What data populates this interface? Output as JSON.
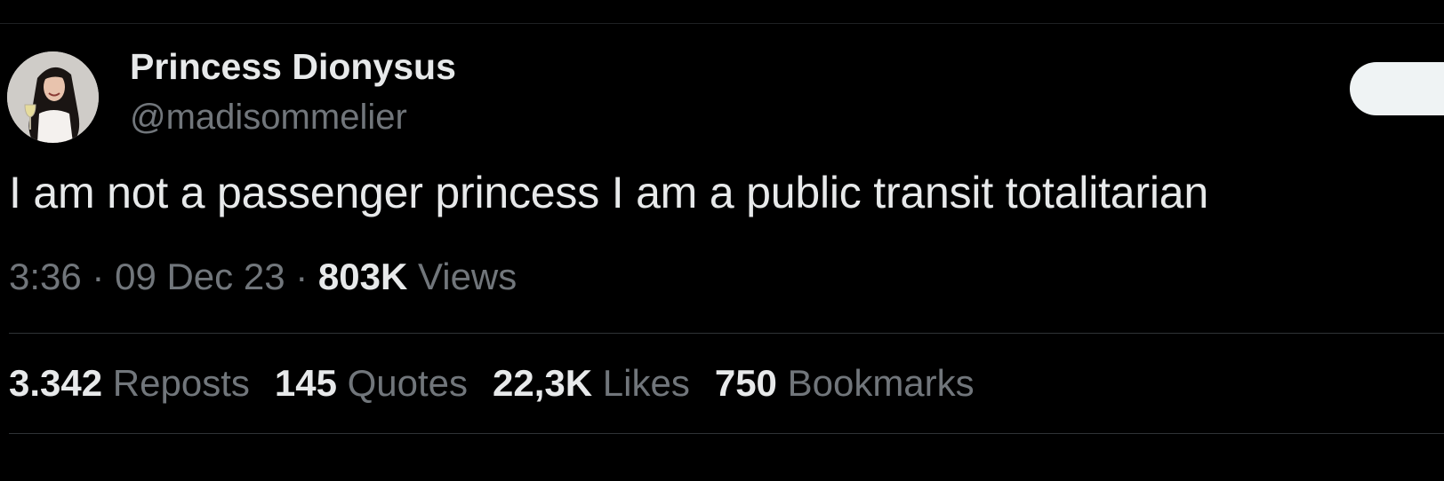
{
  "author": {
    "display_name": "Princess Dionysus",
    "handle": "@madisommelier"
  },
  "tweet": {
    "text": "I am not a passenger princess I am a public transit totalitarian",
    "time": "3:36",
    "separator": "·",
    "date": "09 Dec 23",
    "views_count": "803K",
    "views_label": "Views"
  },
  "stats": {
    "reposts": {
      "count": "3.342",
      "label": "Reposts"
    },
    "quotes": {
      "count": "145",
      "label": "Quotes"
    },
    "likes": {
      "count": "22,3K",
      "label": "Likes"
    },
    "bookmarks": {
      "count": "750",
      "label": "Bookmarks"
    }
  },
  "colors": {
    "background": "#000000",
    "primary_text": "#e7e9ea",
    "secondary_text": "#71767b",
    "divider": "#2f3336",
    "button_bg": "#eff3f4"
  }
}
